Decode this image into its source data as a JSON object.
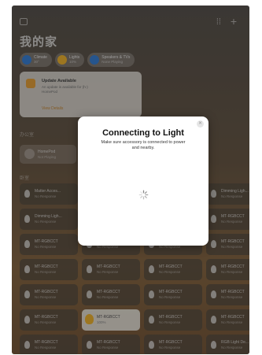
{
  "header": {
    "home_title": "我的家",
    "sidebar_icon": "sidebar-icon",
    "grid_icon": "waveform-icon",
    "add_icon": "plus-icon"
  },
  "chips": [
    {
      "name": "Climate",
      "value": "30°",
      "color": "#3b83d9"
    },
    {
      "name": "Lights",
      "value": "10%",
      "color": "#f2b632"
    },
    {
      "name": "Speakers & TVs",
      "value": "None Playing",
      "color": "#3b83d9"
    }
  ],
  "update_card": {
    "title": "Update Available",
    "desc_line1": "An update is available for (h-)",
    "desc_line2": "HomePod",
    "link": "View Details",
    "accent": "#e8a33c"
  },
  "sections": {
    "office": "办公室",
    "room": "卧室"
  },
  "homepod": {
    "name": "HomePod",
    "status": "Not Playing"
  },
  "modal": {
    "title": "Connecting to Light",
    "subtitle_line1": "Make sure accessory is connected to power",
    "subtitle_line2": "and nearby."
  },
  "tiles": [
    {
      "name": "Matter Acces...",
      "status": "No Response",
      "lit": false
    },
    {
      "name": "Dimming Ligh...",
      "status": "No Response",
      "lit": false
    },
    {
      "name": "Dimming Ligh...",
      "status": "No Response",
      "lit": false
    },
    {
      "name": "MT-RGBCCT",
      "status": "No Response",
      "lit": false
    },
    {
      "name": "MT-RGBCCT",
      "status": "No Response",
      "lit": false
    },
    {
      "name": "MT-RGBCCT",
      "status": "No Response",
      "lit": false
    },
    {
      "name": "MT-RGBCCT",
      "status": "No Response",
      "lit": false
    },
    {
      "name": "MT-RGBCCT",
      "status": "No Response",
      "lit": false
    },
    {
      "name": "MT-RGBCCT",
      "status": "No Response",
      "lit": false
    },
    {
      "name": "MT-RGBCCT",
      "status": "No Response",
      "lit": false
    },
    {
      "name": "MT-RGBCCT",
      "status": "No Response",
      "lit": false
    },
    {
      "name": "MT-RGBCCT",
      "status": "No Response",
      "lit": false
    },
    {
      "name": "MT-RGBCCT",
      "status": "No Response",
      "lit": false
    },
    {
      "name": "MT-RGBCCT",
      "status": "No Response",
      "lit": false
    },
    {
      "name": "MT-RGBCCT",
      "status": "No Response",
      "lit": false
    },
    {
      "name": "MT-RGBCCT",
      "status": "No Response",
      "lit": false
    },
    {
      "name": "MT-RGBCCT",
      "status": "No Response",
      "lit": false
    },
    {
      "name": "MT-RGBCCT",
      "status": "No Response",
      "lit": false
    },
    {
      "name": "MT-RGBCCT",
      "status": "100%",
      "lit": true
    },
    {
      "name": "MT-RGBCCT",
      "status": "No Response",
      "lit": false
    },
    {
      "name": "MT-RGBCCT",
      "status": "No Response",
      "lit": false
    },
    {
      "name": "MT-RGBCCT",
      "status": "No Response",
      "lit": false
    },
    {
      "name": "MT-RGBCCT",
      "status": "No Response",
      "lit": false
    },
    {
      "name": "MT-RGBCCT",
      "status": "No Response",
      "lit": false
    },
    {
      "name": "MT-RGBCCT",
      "status": "No Response",
      "lit": false
    },
    {
      "name": "RGB Light De...",
      "status": "No Response",
      "lit": false
    }
  ]
}
